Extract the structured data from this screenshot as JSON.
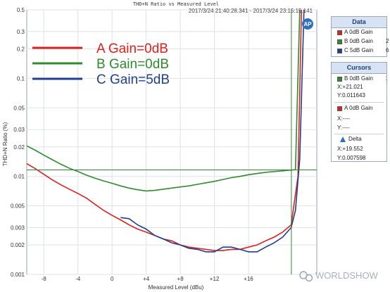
{
  "chart_data": {
    "type": "line",
    "title": "THD+N Ratio vs Measured Level",
    "timestamp": "2017/3/24 21:40:28.341 - 2017/3/24 23:15:15.141",
    "xlabel": "Measured Level (dBu)",
    "ylabel": "THD+N Ratio (%)",
    "y_scale": "log",
    "xlim": [
      -10,
      24
    ],
    "ylim": [
      0.001,
      0.5
    ],
    "x_ticks": [
      "-8",
      "-4",
      "0",
      "+4",
      "+8",
      "+12",
      "+16"
    ],
    "x_tick_values": [
      -8,
      -4,
      0,
      4,
      8,
      12,
      16
    ],
    "y_ticks": [
      "0.5",
      "0.3",
      "0.2",
      "0.1",
      "0.05",
      "0.03",
      "0.02",
      "0.01",
      "0.005",
      "0.003",
      "0.002",
      "0.001"
    ],
    "y_tick_values": [
      0.5,
      0.3,
      0.2,
      0.1,
      0.05,
      0.03,
      0.02,
      0.01,
      0.005,
      0.003,
      0.002,
      0.001
    ],
    "grid": true,
    "legend_entries": [
      {
        "label": "A Gain=0dB",
        "color": "#e0201c"
      },
      {
        "label": "B Gain=0dB",
        "color": "#2e8b2e"
      },
      {
        "label": "C Gain=5dB",
        "color": "#1f3f8f"
      }
    ],
    "series": [
      {
        "name": "A 0dB Gain",
        "color": "#e0201c",
        "x": [
          -10,
          -9,
          -8,
          -7,
          -6,
          -5,
          -4,
          -3,
          -2,
          -1,
          0,
          1,
          2,
          3,
          4,
          5,
          6,
          7,
          8,
          9,
          10,
          11,
          12,
          13,
          14,
          15,
          16,
          17,
          18,
          19,
          20,
          21,
          21.8,
          22.2
        ],
        "y": [
          0.0135,
          0.012,
          0.0105,
          0.0092,
          0.0082,
          0.0074,
          0.0067,
          0.006,
          0.0052,
          0.0045,
          0.004,
          0.0036,
          0.0032,
          0.0029,
          0.0027,
          0.0025,
          0.0023,
          0.0022,
          0.002,
          0.0019,
          0.00185,
          0.0018,
          0.00175,
          0.00175,
          0.0018,
          0.0018,
          0.0019,
          0.002,
          0.0022,
          0.0024,
          0.0027,
          0.0032,
          0.01,
          0.5
        ]
      },
      {
        "name": "B 0dB Gain",
        "color": "#2e8b2e",
        "x": [
          -10,
          -9,
          -8,
          -7,
          -6,
          -5,
          -4,
          -3,
          -2,
          -1,
          0,
          1,
          2,
          3,
          4,
          5,
          6,
          7,
          8,
          9,
          10,
          11,
          12,
          13,
          14,
          15,
          16,
          17,
          18,
          19,
          20,
          21,
          21.5,
          22.0
        ],
        "y": [
          0.0205,
          0.0185,
          0.0165,
          0.0148,
          0.0133,
          0.0121,
          0.0112,
          0.0103,
          0.0096,
          0.009,
          0.0085,
          0.008,
          0.0076,
          0.0073,
          0.0071,
          0.0072,
          0.0074,
          0.0076,
          0.0078,
          0.008,
          0.0083,
          0.0086,
          0.0089,
          0.0093,
          0.0097,
          0.01,
          0.0104,
          0.0107,
          0.011,
          0.0112,
          0.0114,
          0.0116,
          0.0117,
          0.5
        ]
      },
      {
        "name": "C 5dB Gain",
        "color": "#1f3f8f",
        "x": [
          1,
          2,
          3,
          4,
          5,
          6,
          7,
          8,
          9,
          10,
          11,
          12,
          13,
          14,
          15,
          16,
          17,
          18,
          19,
          20,
          21,
          21.5,
          22.0,
          22.5
        ],
        "y": [
          0.0038,
          0.0037,
          0.0032,
          0.0029,
          0.0025,
          0.0023,
          0.0021,
          0.002,
          0.00185,
          0.0018,
          0.0017,
          0.0017,
          0.0019,
          0.0019,
          0.0018,
          0.0017,
          0.0017,
          0.0019,
          0.0021,
          0.0024,
          0.003,
          0.0045,
          0.015,
          0.5
        ]
      }
    ],
    "cursor": {
      "x": 21.021,
      "y": 0.011643,
      "color": "#2e8b2e"
    }
  },
  "ap_logo": "AP",
  "watermark": "WORLDSHOW",
  "panels": {
    "data": {
      "title": "Data",
      "items": [
        {
          "label": "A 0dB Gain",
          "num": "",
          "color": "#e0201c"
        },
        {
          "label": "B 0dB Gain",
          "num": "2",
          "color": "#2e8b2e"
        },
        {
          "label": "C 5dB Gain",
          "num": "6",
          "color": "#1f3f8f"
        }
      ]
    },
    "cursors": {
      "title": "Cursors",
      "cursor1": {
        "label": "B 0dB Gain",
        "num": "2",
        "color": "#2e8b2e",
        "x": "X:+21.021",
        "y": "Y:0.011643"
      },
      "cursor2": {
        "label": "A 0dB Gain",
        "color": "#e0201c",
        "x": "X:----",
        "y": "Y:----"
      },
      "delta": {
        "label": "Delta",
        "x": "X:+19.552",
        "y": "Y:0.007598"
      }
    }
  }
}
